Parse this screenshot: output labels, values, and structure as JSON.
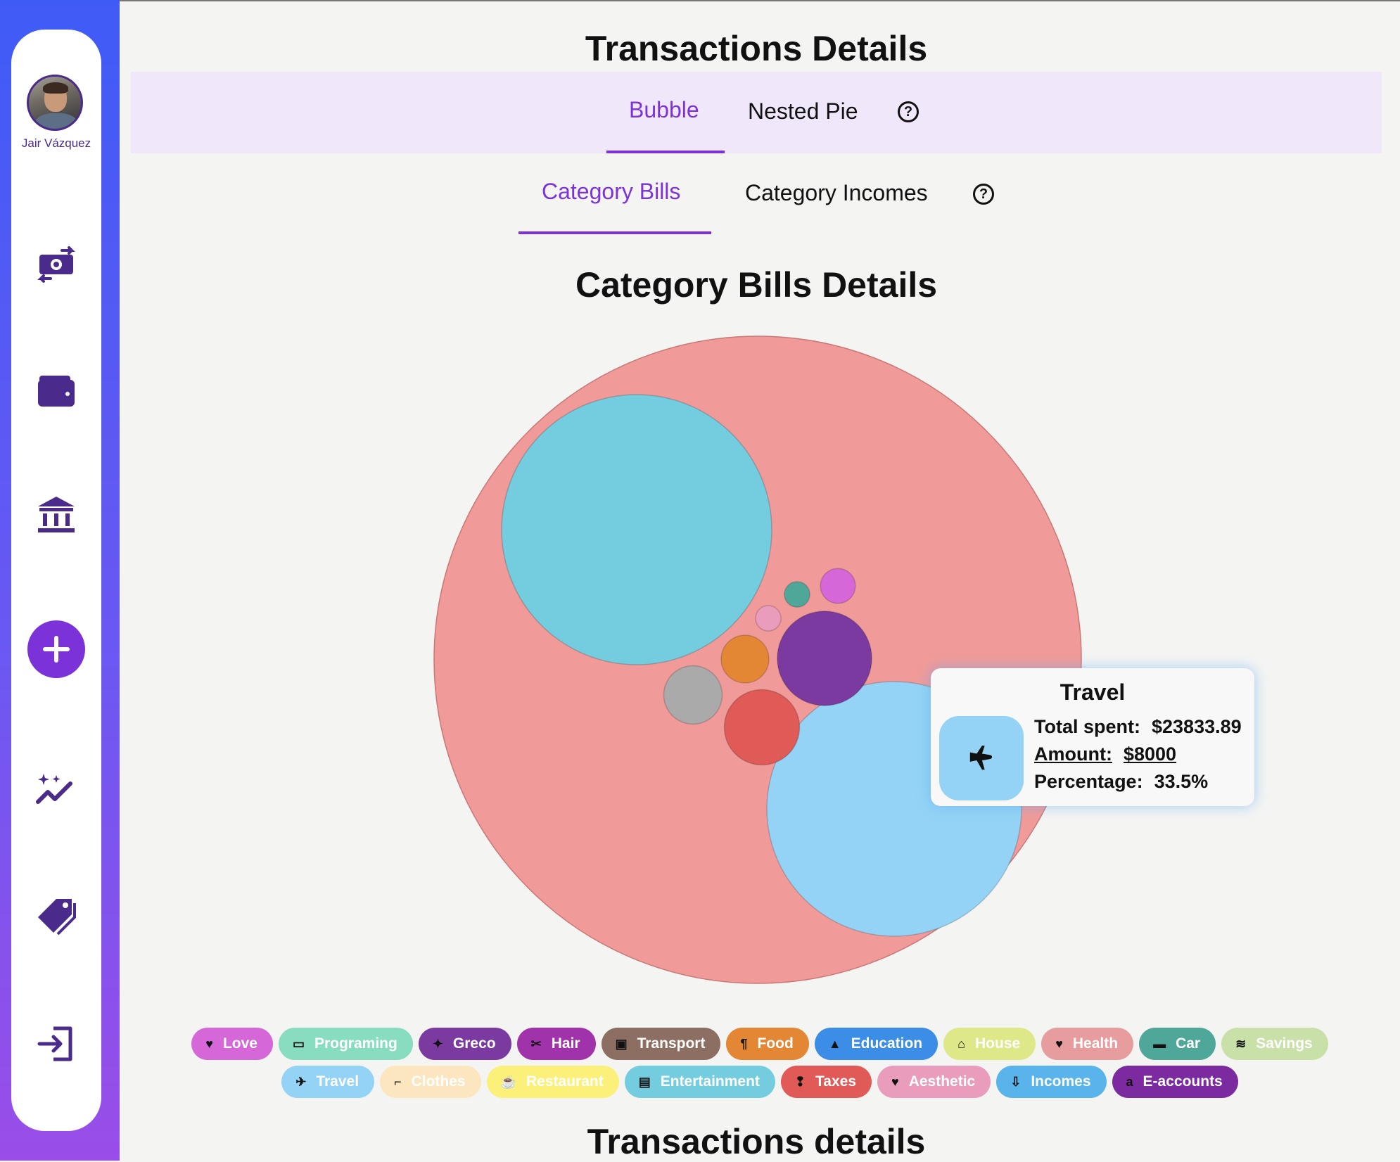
{
  "user": {
    "name": "Jair Vázquez"
  },
  "sidebar": {
    "nav": [
      {
        "icon": "money-exchange-icon"
      },
      {
        "icon": "wallet-icon"
      },
      {
        "icon": "bank-icon"
      },
      {
        "icon": "add-icon"
      },
      {
        "icon": "sparkle-chart-icon"
      },
      {
        "icon": "tags-icon"
      },
      {
        "icon": "logout-icon"
      }
    ]
  },
  "page": {
    "title": "Transactions Details",
    "tabs": [
      {
        "label": "Bubble"
      },
      {
        "label": "Nested Pie"
      }
    ],
    "subtabs": [
      {
        "label": "Category Bills"
      },
      {
        "label": "Category Incomes"
      }
    ],
    "help_glyph": "?",
    "chart_title": "Category Bills Details",
    "footer_title": "Transactions details"
  },
  "tooltip": {
    "title": "Travel",
    "icon": "airplane-icon",
    "total_label": "Total spent:",
    "total_value": "$23833.89",
    "amount_label": "Amount:",
    "amount_value": "$8000",
    "percentage_label": "Percentage:",
    "percentage_value": "33.5%"
  },
  "chart_data": {
    "type": "bubble",
    "root_color": "#f09b99",
    "bubbles": [
      {
        "color": "#74cddf",
        "value": 9000
      },
      {
        "color": "#94d3f5",
        "value": 8000
      },
      {
        "color": "#7b3aa0",
        "value": 1100
      },
      {
        "color": "#e05b57",
        "value": 700
      },
      {
        "color": "#aaaaaa",
        "value": 420
      },
      {
        "color": "#e38735",
        "value": 280
      },
      {
        "color": "#d567d8",
        "value": 150
      },
      {
        "color": "#e99cbb",
        "value": 80
      },
      {
        "color": "#4fa79a",
        "value": 80
      }
    ]
  },
  "legend": [
    [
      {
        "label": "Love",
        "color": "#d567d8",
        "icon": "♥"
      },
      {
        "label": "Programing",
        "color": "#88dcc0",
        "icon": "▭"
      },
      {
        "label": "Greco",
        "color": "#7b3aa0",
        "icon": "✦"
      },
      {
        "label": "Hair",
        "color": "#a033aa",
        "icon": "✂"
      },
      {
        "label": "Transport",
        "color": "#8c6e62",
        "icon": "▣"
      },
      {
        "label": "Food",
        "color": "#e38735",
        "icon": "¶"
      },
      {
        "label": "Education",
        "color": "#3c8de6",
        "icon": "▲"
      },
      {
        "label": "House",
        "color": "#dfe888",
        "icon": "⌂"
      },
      {
        "label": "Health",
        "color": "#e79d9d",
        "icon": "♥"
      },
      {
        "label": "Car",
        "color": "#4fa79a",
        "icon": "▬"
      },
      {
        "label": "Savings",
        "color": "#c9e0a8",
        "icon": "≋"
      }
    ],
    [
      {
        "label": "Travel",
        "color": "#94d3f5",
        "icon": "✈"
      },
      {
        "label": "Clothes",
        "color": "#fbe6c0",
        "icon": "⌐"
      },
      {
        "label": "Restaurant",
        "color": "#faf07a",
        "icon": "☕"
      },
      {
        "label": "Entertainment",
        "color": "#74cddf",
        "icon": "▤"
      },
      {
        "label": "Taxes",
        "color": "#e05b57",
        "icon": "❢"
      },
      {
        "label": "Aesthetic",
        "color": "#e99cbb",
        "icon": "♥"
      },
      {
        "label": "Incomes",
        "color": "#5ab4ec",
        "icon": "⇩"
      },
      {
        "label": "E-accounts",
        "color": "#7b2aa0",
        "icon": "a"
      }
    ]
  ]
}
